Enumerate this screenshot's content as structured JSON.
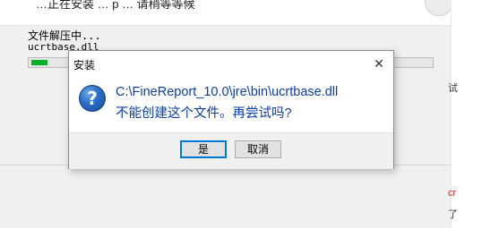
{
  "background_window": {
    "header_text": "…正在安装 … p … 请稍等等候",
    "status_text": "文件解压中...",
    "current_file": "ucrtbase.dll",
    "progress_percent": 4,
    "edge_fragments": [
      "试",
      "cr",
      "了"
    ]
  },
  "dialog": {
    "title": "安装",
    "close_symbol": "✕",
    "icon": "question-icon",
    "message_path": "C:\\FineReport_10.0\\jre\\bin\\ucrtbase.dll",
    "message_question": "不能创建这个文件。再尝试吗?",
    "buttons": {
      "yes": "是",
      "cancel": "取消"
    }
  },
  "colors": {
    "message_text": "#0b3ea8",
    "progress_fill": "#06b025",
    "focus_border": "#0078d7"
  }
}
